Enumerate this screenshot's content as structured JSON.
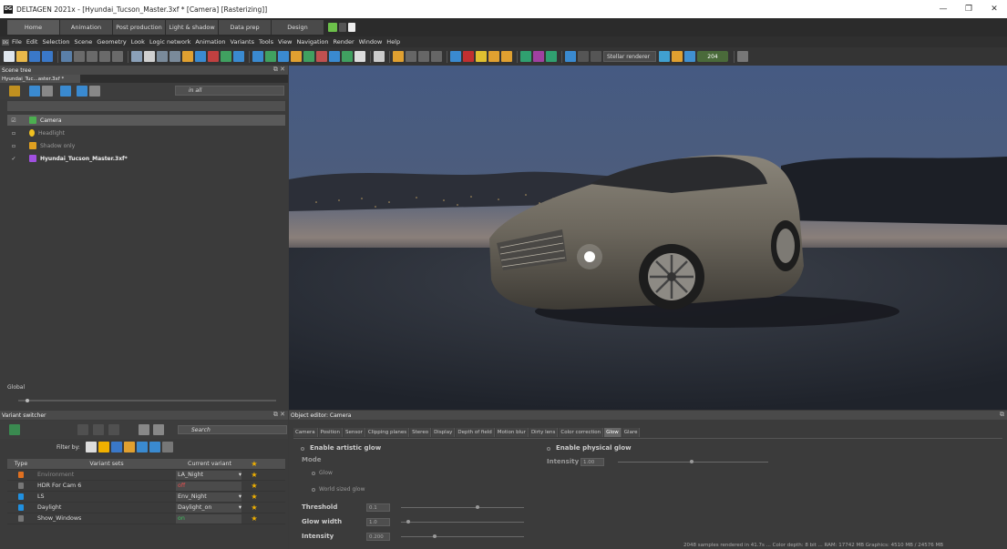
{
  "window": {
    "title": "DELTAGEN 2021x - [Hyundai_Tucson_Master.3xf * [Camera] [Rasterizing]]",
    "app_icon": "DG",
    "minimize": "—",
    "maximize": "❐",
    "close": "✕"
  },
  "mode_tabs": [
    "Home",
    "Animation",
    "Post production",
    "Light & shadow",
    "Data prep",
    "Design"
  ],
  "menu": [
    "File",
    "Edit",
    "Selection",
    "Scene",
    "Geometry",
    "Look",
    "Logic network",
    "Animation",
    "Variants",
    "Tools",
    "View",
    "Navigation",
    "Render",
    "Window",
    "Help"
  ],
  "toolbar": {
    "renderer": "Stellar renderer",
    "counter": "204"
  },
  "scene_tree": {
    "title": "Scene tree",
    "file_tab": "Hyundai_Tuc...aster.3xf *",
    "filter": "in all",
    "items": [
      {
        "check": "☑",
        "label": "Camera",
        "icon_color": "#4caf50"
      },
      {
        "check": "▫",
        "label": "Headlight",
        "icon_color": "#f0c020"
      },
      {
        "check": "▫",
        "label": "Shadow only",
        "icon_color": "#e0a020"
      },
      {
        "check": "✓",
        "label": "Hyundai_Tucson_Master.3xf*",
        "icon_color": "#a050e0"
      }
    ],
    "global_label": "Global"
  },
  "variant_switcher": {
    "title": "Variant switcher",
    "search_placeholder": "Search",
    "filter_by": "Filter by:",
    "columns": [
      "Type",
      "Variant sets",
      "Current variant"
    ],
    "rows": [
      {
        "set": "Environment",
        "current": "LA_Night",
        "icon_color": "#e07020",
        "dim": true
      },
      {
        "set": "HDR For Cam 6",
        "current": "off",
        "icon_color": "#777777",
        "dim": false
      },
      {
        "set": "LS",
        "current": "Env_Night",
        "icon_color": "#2090e0",
        "dim": false
      },
      {
        "set": "Daylight",
        "current": "Daylight_on",
        "icon_color": "#2090e0",
        "dim": false
      },
      {
        "set": "Show_Windows",
        "current": "on",
        "icon_color": "#777777",
        "dim": false
      }
    ]
  },
  "object_editor": {
    "title": "Object editor: Camera",
    "tabs": [
      "Camera",
      "Position",
      "Sensor",
      "Clipping planes",
      "Stereo",
      "Display",
      "Depth of field",
      "Motion blur",
      "Dirty lens",
      "Color correction",
      "Glow",
      "Glare"
    ],
    "active_tab": "Glow",
    "artistic_glow": "Enable artistic glow",
    "mode_label": "Mode",
    "mode_glow": "Glow",
    "mode_world": "World sized glow",
    "threshold_label": "Threshold",
    "threshold_value": "0.1",
    "glow_width_label": "Glow width",
    "glow_width_value": "1.0",
    "intensity_label": "Intensity",
    "intensity_value": "0.200",
    "physical_glow": "Enable physical glow",
    "phys_intensity_label": "Intensity",
    "phys_intensity_value": "1.00"
  },
  "status": "2048 samples rendered in 41.7s ... Color depth: 8 bit ... RAM: 17742 MB Graphics: 4510 MB / 24576 MB"
}
